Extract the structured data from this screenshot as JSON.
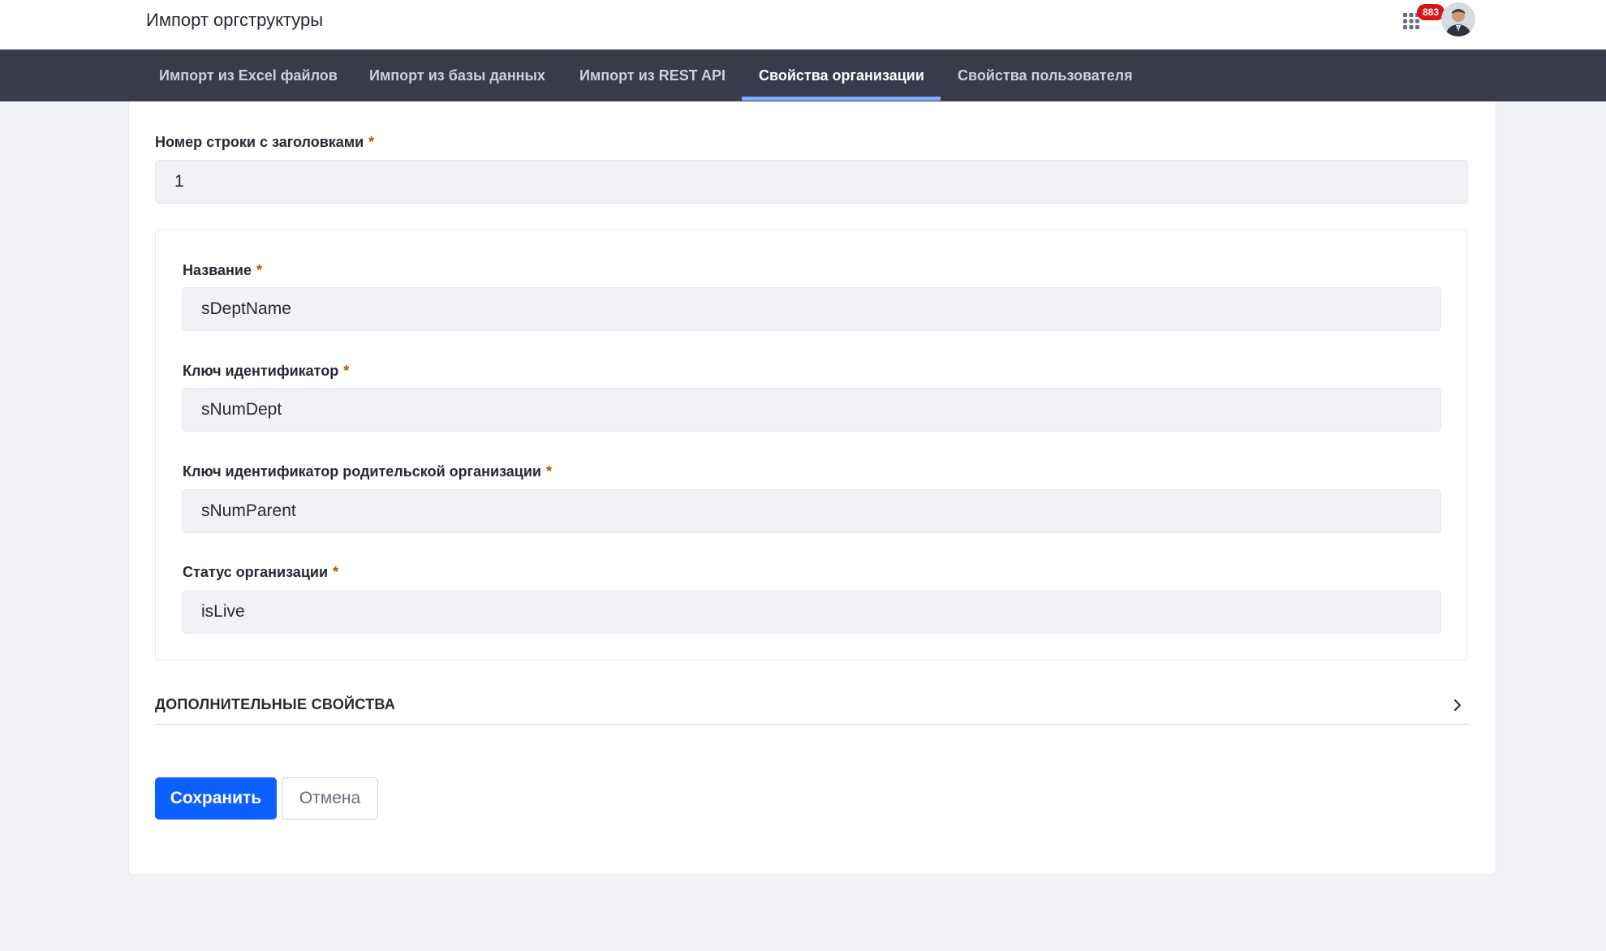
{
  "header": {
    "title": "Импорт оргструктуры",
    "notification_count": "883",
    "apps_icon": "apps-grid-icon",
    "avatar_icon": "user-avatar"
  },
  "nav": {
    "tabs": [
      {
        "label": "Импорт из Excel файлов",
        "active": false
      },
      {
        "label": "Импорт из базы данных",
        "active": false
      },
      {
        "label": "Импорт из REST API",
        "active": false
      },
      {
        "label": "Свойства организации",
        "active": true
      },
      {
        "label": "Свойства пользователя",
        "active": false
      }
    ]
  },
  "form": {
    "header_row": {
      "label": "Номер строки с заголовками",
      "required_mark": "*",
      "value": "1"
    },
    "fields": [
      {
        "label": "Название",
        "required_mark": "*",
        "value": "sDeptName"
      },
      {
        "label": "Ключ идентификатор",
        "required_mark": "*",
        "value": "sNumDept"
      },
      {
        "label": "Ключ идентификатор родительской организации",
        "required_mark": "*",
        "value": "sNumParent"
      },
      {
        "label": "Статус организации",
        "required_mark": "*",
        "value": "isLive"
      }
    ],
    "additional_section": {
      "title": "ДОПОЛНИТЕЛЬНЫЕ СВОЙСТВА",
      "icon": "chevron-right-icon"
    },
    "save_label": "Сохранить",
    "cancel_label": "Отмена"
  },
  "colors": {
    "primary": "#0b5fff",
    "navbar": "#393a4a",
    "active_tab_indicator": "#80acff",
    "badge": "#da1414",
    "required": "#b95000"
  }
}
